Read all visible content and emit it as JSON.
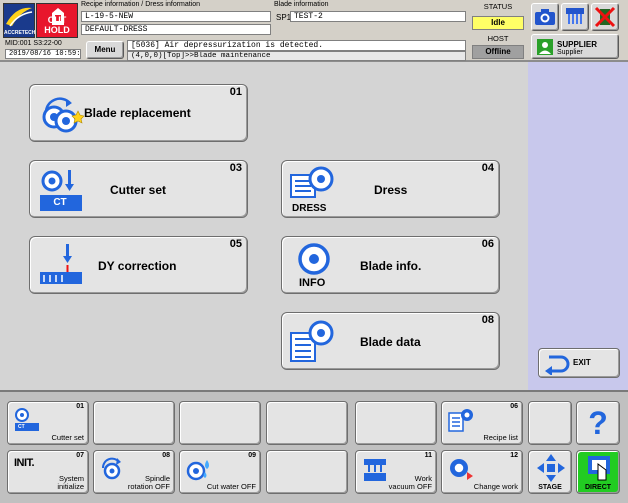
{
  "header": {
    "brand": "ACCRETECH",
    "cut_hold": "CUT HOLD",
    "recipe_caption": "Recipe information / Dress information",
    "recipe_name": "L-19-5-NEW",
    "dress_name": "DEFAULT-DRESS",
    "blade_caption": "Blade information",
    "blade_spindle": "SP1",
    "blade_name": "TEST-2",
    "status_caption": "STATUS",
    "status_value": "Idle",
    "host_caption": "HOST",
    "host_value": "Offline",
    "machine_id": "MID:001  S3:22-00",
    "datetime": "2019/08/16 10:59:51",
    "menu_label": "Menu",
    "message": "[5036] Air depressurization is detected.",
    "breadcrumb": "(4,0,0)[Top]>>Blade maintenance",
    "supplier_label": "SUPPLIER",
    "supplier_sub": "Supplier",
    "colors": {
      "status_idle": "#ffff66",
      "host_offline": "#a0a0a0",
      "cut_hold_bg": "#e8162c",
      "side_panel": "#c8c8ec",
      "direct_green": "#22cc22"
    }
  },
  "main_buttons": [
    {
      "num": "01",
      "label": "Blade replacement",
      "icon": "blade-replacement-icon"
    },
    {
      "num": "03",
      "label": "Cutter set",
      "icon": "cutter-set-icon",
      "badge": "CT"
    },
    {
      "num": "04",
      "label": "Dress",
      "icon": "dress-icon",
      "badge": "DRESS"
    },
    {
      "num": "05",
      "label": "DY correction",
      "icon": "dy-correction-icon"
    },
    {
      "num": "06",
      "label": "Blade info.",
      "icon": "blade-info-icon",
      "badge": "INFO"
    },
    {
      "num": "08",
      "label": "Blade data",
      "icon": "blade-data-icon"
    }
  ],
  "exit_label": "EXIT",
  "function_keys": {
    "row1": [
      {
        "num": "01",
        "label": "Cutter set",
        "icon": "cutter-set-icon",
        "badge": "CT"
      },
      {
        "num": "",
        "label": ""
      },
      {
        "num": "",
        "label": ""
      },
      {
        "num": "",
        "label": ""
      },
      {
        "num": "",
        "label": ""
      },
      {
        "num": "06",
        "label": "Recipe list",
        "icon": "recipe-list-icon"
      }
    ],
    "row2": [
      {
        "num": "07",
        "label1": "System",
        "label2": "initialize",
        "icon": "init-icon",
        "badge": "INIT."
      },
      {
        "num": "08",
        "label1": "Spindle",
        "label2": "rotation OFF",
        "icon": "spindle-rotation-icon"
      },
      {
        "num": "09",
        "label1": "",
        "label2": "Cut water OFF",
        "icon": "cut-water-icon"
      },
      {
        "num": "",
        "label1": "",
        "label2": ""
      },
      {
        "num": "11",
        "label1": "Work",
        "label2": "vacuum OFF",
        "icon": "work-vacuum-icon"
      },
      {
        "num": "12",
        "label1": "",
        "label2": "Change work",
        "icon": "change-work-icon"
      }
    ]
  },
  "right_keys": {
    "help_glyph": "?",
    "stage_label": "STAGE",
    "direct_label": "DIRECT"
  }
}
